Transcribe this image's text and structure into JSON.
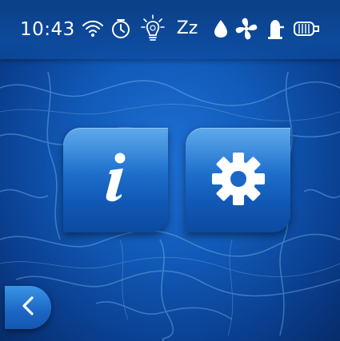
{
  "status_bar": {
    "time": "10:43",
    "icons": [
      "wifi-icon",
      "timer-icon",
      "light-bulb-icon",
      "sleep-icon",
      "water-drop-icon",
      "fan-icon",
      "heater-icon",
      "filter-icon"
    ],
    "sleep_text": "Zz"
  },
  "main": {
    "tiles": [
      {
        "name": "info",
        "icon": "info-icon"
      },
      {
        "name": "settings",
        "icon": "gear-icon"
      }
    ]
  },
  "navigation": {
    "back_icon": "chevron-left-icon"
  },
  "colors": {
    "background": "#115ab8",
    "tile": "#2176d1",
    "icon": "#ffffff"
  }
}
